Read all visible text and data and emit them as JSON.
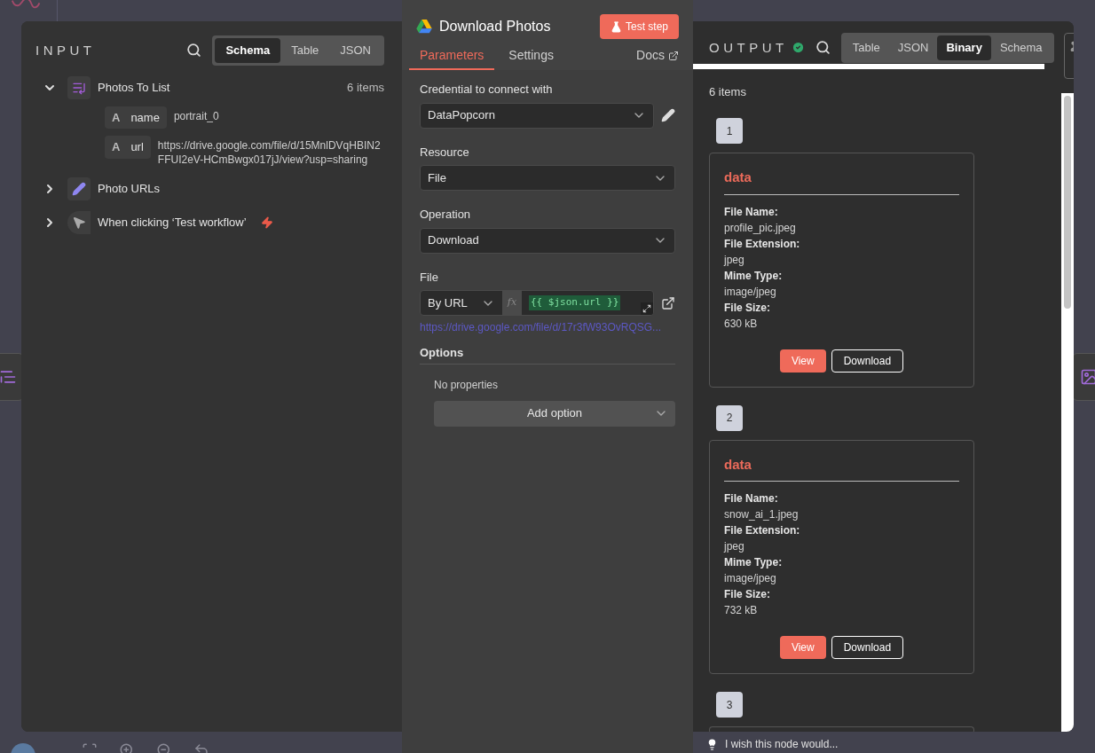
{
  "input": {
    "title": "INPUT",
    "views": [
      {
        "label": "Schema",
        "selected": true
      },
      {
        "label": "Table",
        "selected": false
      },
      {
        "label": "JSON",
        "selected": false
      }
    ],
    "nodes": [
      {
        "kind": "list",
        "name": "Photos To List",
        "count": "6 items",
        "expanded": true,
        "trigger": false,
        "fields": [
          {
            "type": "A",
            "key": "name",
            "value": "portrait_0"
          },
          {
            "type": "A",
            "key": "url",
            "value": "https://drive.google.com/file/d/15MnlDVqHBIN2FFUI2eV-HCmBwgx017jJ/view?usp=sharing"
          }
        ]
      },
      {
        "kind": "edit",
        "name": "Photo URLs",
        "expanded": false,
        "trigger": false
      },
      {
        "kind": "click",
        "name": "When clicking ‘Test workflow’",
        "expanded": false,
        "trigger": true
      }
    ]
  },
  "node": {
    "title": "Download Photos",
    "test_button": "Test step",
    "tabs": [
      {
        "label": "Parameters",
        "selected": true
      },
      {
        "label": "Settings",
        "selected": false
      }
    ],
    "docs": "Docs",
    "params": [
      {
        "kind": "credential",
        "label": "Credential to connect with",
        "value": "DataPopcorn"
      },
      {
        "kind": "select",
        "label": "Resource",
        "value": "File"
      },
      {
        "kind": "select",
        "label": "Operation",
        "value": "Download"
      },
      {
        "kind": "expression",
        "label": "File",
        "mode": "By URL",
        "fx": "fx",
        "expression": "{{ $json.url }}",
        "preview": "https://drive.google.com/file/d/17r3fW93OvRQSG..."
      }
    ],
    "options": {
      "title": "Options",
      "empty": "No properties",
      "add": "Add option"
    }
  },
  "output": {
    "title": "OUTPUT",
    "success": true,
    "views": [
      {
        "label": "Table",
        "selected": false
      },
      {
        "label": "JSON",
        "selected": false
      },
      {
        "label": "Binary",
        "selected": true
      },
      {
        "label": "Schema",
        "selected": false
      }
    ],
    "count": "6 items",
    "items": [
      {
        "number": "1",
        "key": "data",
        "fields": [
          {
            "label": "File Name:",
            "value": "profile_pic.jpeg"
          },
          {
            "label": "File Extension:",
            "value": "jpeg"
          },
          {
            "label": "Mime Type:",
            "value": "image/jpeg"
          },
          {
            "label": "File Size:",
            "value": "630 kB"
          }
        ],
        "actions": [
          "View",
          "Download"
        ]
      },
      {
        "number": "2",
        "key": "data",
        "fields": [
          {
            "label": "File Name:",
            "value": "snow_ai_1.jpeg"
          },
          {
            "label": "File Extension:",
            "value": "jpeg"
          },
          {
            "label": "Mime Type:",
            "value": "image/jpeg"
          },
          {
            "label": "File Size:",
            "value": "732 kB"
          }
        ],
        "actions": [
          "View",
          "Download"
        ]
      },
      {
        "number": "3"
      }
    ],
    "feedback": "I wish this node would..."
  }
}
